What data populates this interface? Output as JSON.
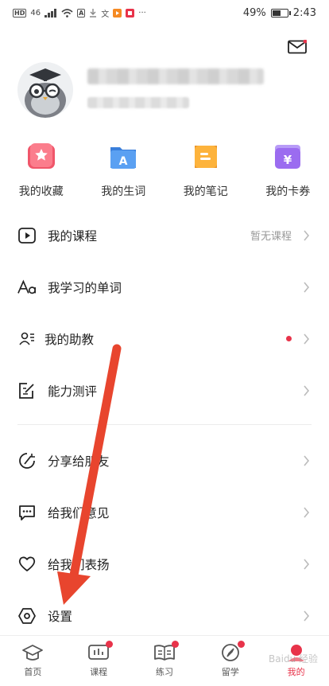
{
  "status_bar": {
    "signal_label": "46",
    "battery_percent": "49%",
    "battery_level": 0.49,
    "time": "2:43",
    "more": "···"
  },
  "header": {
    "mail_icon": "mail-icon"
  },
  "quick_actions": [
    {
      "label": "我的收藏",
      "icon": "star-icon",
      "color": "#f0566a"
    },
    {
      "label": "我的生词",
      "icon": "folder-a-icon",
      "color": "#4a90e8"
    },
    {
      "label": "我的笔记",
      "icon": "note-icon",
      "color": "#f5a623"
    },
    {
      "label": "我的卡券",
      "icon": "coupon-icon",
      "color": "#9b6cf0"
    }
  ],
  "menu": [
    {
      "label": "我的课程",
      "hint": "暂无课程",
      "icon": "play-icon"
    },
    {
      "label": "我学习的单词",
      "hint": "",
      "icon": "font-icon"
    },
    {
      "label": "我的助教",
      "hint": "",
      "icon": "assistant-icon",
      "dot": true
    },
    {
      "label": "能力测评",
      "hint": "",
      "icon": "edit-icon"
    },
    {
      "label": "分享给朋友",
      "hint": "",
      "icon": "share-icon"
    },
    {
      "label": "给我们意见",
      "hint": "",
      "icon": "feedback-icon"
    },
    {
      "label": "给我们表扬",
      "hint": "",
      "icon": "heart-icon"
    },
    {
      "label": "设置",
      "hint": "",
      "icon": "settings-icon"
    }
  ],
  "bottom_nav": [
    {
      "label": "首页",
      "icon": "home-icon",
      "badge": false,
      "active": false
    },
    {
      "label": "课程",
      "icon": "course-icon",
      "badge": true,
      "active": false
    },
    {
      "label": "练习",
      "icon": "practice-icon",
      "badge": true,
      "active": false
    },
    {
      "label": "留学",
      "icon": "compass-icon",
      "badge": true,
      "active": false
    },
    {
      "label": "我的",
      "icon": "profile-icon",
      "badge": false,
      "active": true
    }
  ],
  "colors": {
    "accent": "#e8334a",
    "annotation_arrow": "#e8452e"
  },
  "watermark": "Baidu 经验"
}
